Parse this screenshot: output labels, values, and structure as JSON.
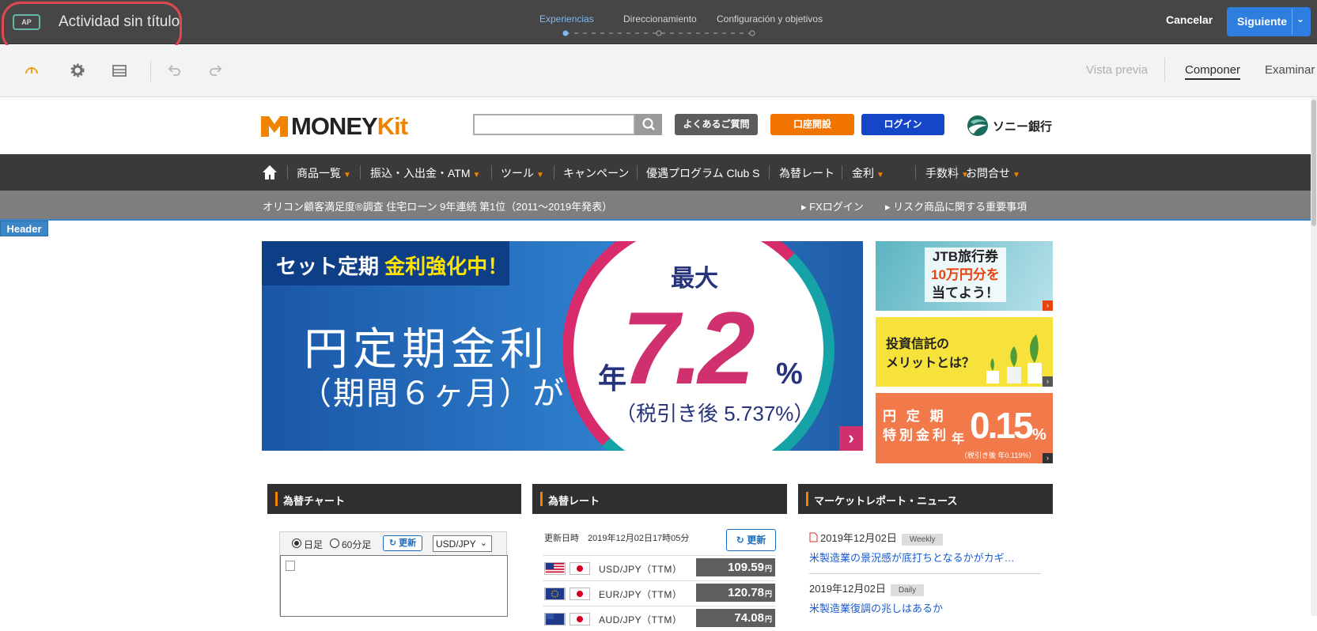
{
  "app": {
    "badge": "AP",
    "activity_title": "Actividad sin título",
    "steps": [
      "Experiencias",
      "Direccionamiento",
      "Configuración y objetivos"
    ],
    "cancel_label": "Cancelar",
    "next_label": "Siguiente",
    "colors": {
      "topbar": "#464646",
      "accent": "#2e7ee0",
      "annotation": "#e0484f"
    }
  },
  "toolbar": {
    "icons": [
      "gauge-icon",
      "gear-icon",
      "layout-icon",
      "undo-icon",
      "redo-icon"
    ],
    "tabs": {
      "preview": "Vista previa",
      "compose": "Componer",
      "browse": "Examinar"
    }
  },
  "site": {
    "logo": {
      "money": "MONEY",
      "kit": "Kit",
      "dot": "."
    },
    "search": {
      "placeholder": ""
    },
    "buttons": {
      "faq": "よくあるご質問",
      "open_account": "口座開設",
      "login": "ログイン"
    },
    "bank_name": "ソニー銀行",
    "nav": [
      "商品一覧",
      "振込・入出金・ATM",
      "ツール",
      "キャンペーン",
      "優遇プログラム Club S",
      "為替レート",
      "金利",
      "手数料",
      "お問合せ"
    ],
    "notice": "オリコン顧客満足度®調査 住宅ローン 9年連続 第1位（2011〜2019年発表）",
    "links": {
      "fx_login": "FXログイン",
      "risk": "リスク商品に関する重要事項"
    },
    "header_tag": "Header",
    "hero": {
      "tag_prefix": "セット定期",
      "tag_highlight": "金利強化中！",
      "line1": "円定期金利",
      "line2": "（期間６ヶ月）が",
      "max": "最大",
      "year": "年",
      "rate": "7.2",
      "percent": "%",
      "note": "（税引き後 5.737%）",
      "arrow": "›"
    },
    "ads": {
      "ad1": {
        "line1": "JTB旅行券",
        "line2": "10万円分を",
        "line3": "当てよう！"
      },
      "ad2": {
        "line1": "投資信託の",
        "line2": "メリットとは？"
      },
      "ad3": {
        "line1": "円 定 期",
        "line2": "特別金利",
        "year": "年",
        "rate": "0.15",
        "percent": "%",
        "note": "（税引き後 年0.119%）"
      }
    },
    "panels": {
      "chart": {
        "title": "為替チャート",
        "radio_day": "日足",
        "radio_60": "60分足",
        "refresh": "更新",
        "pair": "USD/JPY"
      },
      "rates": {
        "title": "為替レート",
        "updated_label": "更新日時",
        "updated_value": "2019年12月02日17時05分",
        "refresh": "更新",
        "unit": "円",
        "rows": [
          {
            "pair": "USD/JPY（TTM）",
            "value": "109.59"
          },
          {
            "pair": "EUR/JPY（TTM）",
            "value": "120.78"
          },
          {
            "pair": "AUD/JPY（TTM）",
            "value": "74.08"
          }
        ]
      },
      "news": {
        "title": "マーケットレポート・ニュース",
        "items": [
          {
            "date": "2019年12月02日",
            "tag": "Weekly",
            "title": "米製造業の景況感が底打ちとなるかがカギ…"
          },
          {
            "date": "2019年12月02日",
            "tag": "Daily",
            "title": "米製造業復調の兆しはあるか"
          }
        ]
      }
    }
  }
}
